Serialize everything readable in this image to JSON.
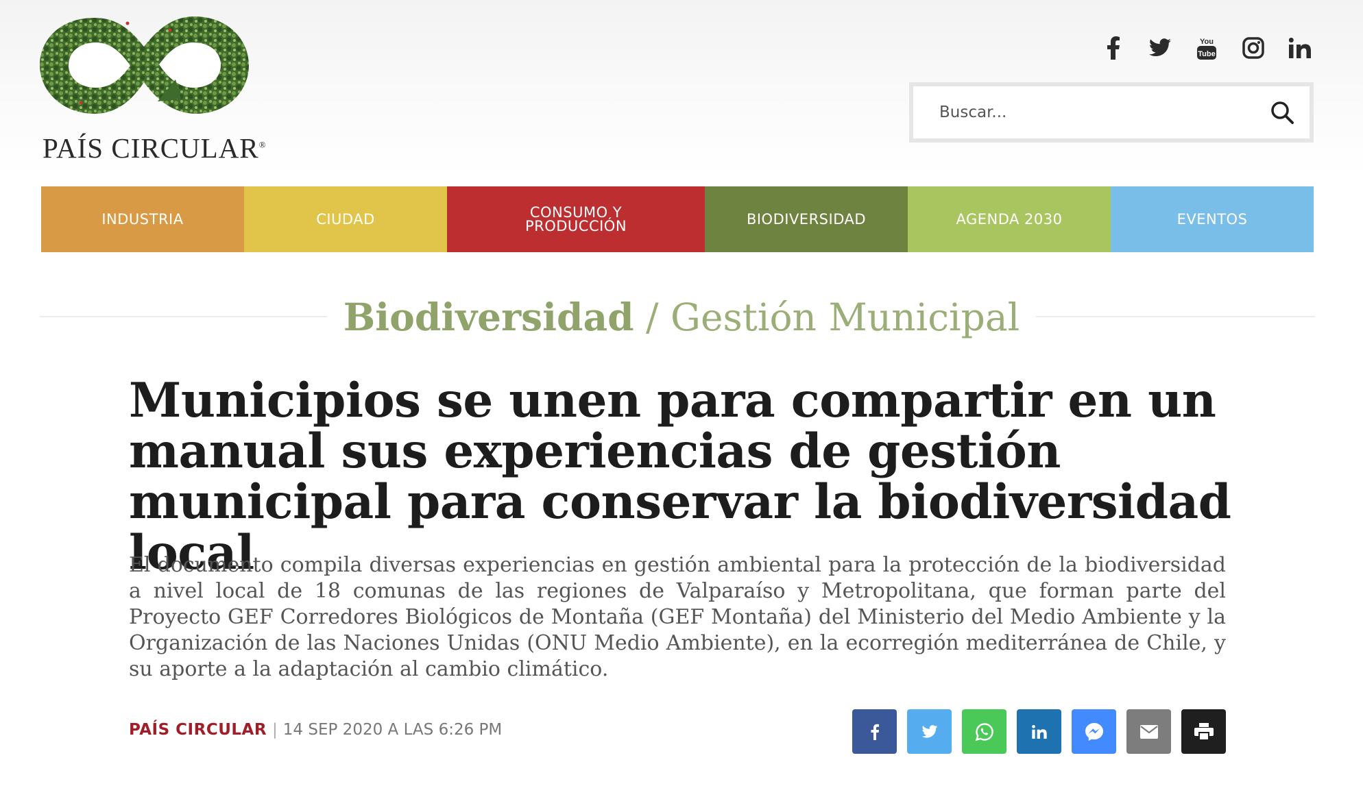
{
  "brand": {
    "name": "PAÍS CIRCULAR",
    "registered": "®"
  },
  "social": [
    "facebook-icon",
    "twitter-icon",
    "youtube-icon",
    "instagram-icon",
    "linkedin-icon"
  ],
  "search": {
    "placeholder": "Buscar..."
  },
  "nav": [
    {
      "label": "INDUSTRIA",
      "color": "#d99a45"
    },
    {
      "label": "CIUDAD",
      "color": "#e0c54a"
    },
    {
      "label": "CONSUMO Y PRODUCCIÓN",
      "color": "#bc2e2f"
    },
    {
      "label": "BIODIVERSIDAD",
      "color": "#6d833f"
    },
    {
      "label": "AGENDA 2030",
      "color": "#a8c55f"
    },
    {
      "label": "EVENTOS",
      "color": "#79bde9"
    }
  ],
  "breadcrumb": {
    "category": "Biodiversidad",
    "separator": "/",
    "subcategory": "Gestión Municipal"
  },
  "article": {
    "title": "Municipios se unen para compartir en un manual sus experiencias de gestión municipal para conservar la biodiversidad local",
    "lead": "El documento compila diversas experiencias en gestión ambiental para la protección de la biodiversidad a nivel local de 18 comunas de las regiones de Valparaíso y Metropolitana, que forman parte del Proyecto GEF Corredores Biológicos de Montaña (GEF Montaña) del Ministerio del Medio Ambiente y la Organización de las Naciones Unidas (ONU Medio Ambiente), en la ecorregión mediterránea de Chile, y su aporte a la adaptación al cambio climático.",
    "author": "PAÍS CIRCULAR",
    "separator": "|",
    "date": "14 SEP 2020 A LAS 6:26 PM"
  },
  "share": [
    {
      "icon": "facebook-icon",
      "color": "#3b5998"
    },
    {
      "icon": "twitter-icon",
      "color": "#55acee"
    },
    {
      "icon": "whatsapp-icon",
      "color": "#4ac959"
    },
    {
      "icon": "linkedin-icon",
      "color": "#1f72b0"
    },
    {
      "icon": "messenger-icon",
      "color": "#448aff"
    },
    {
      "icon": "email-icon",
      "color": "#7d7d7d"
    },
    {
      "icon": "print-icon",
      "color": "#1f1f1f"
    }
  ]
}
